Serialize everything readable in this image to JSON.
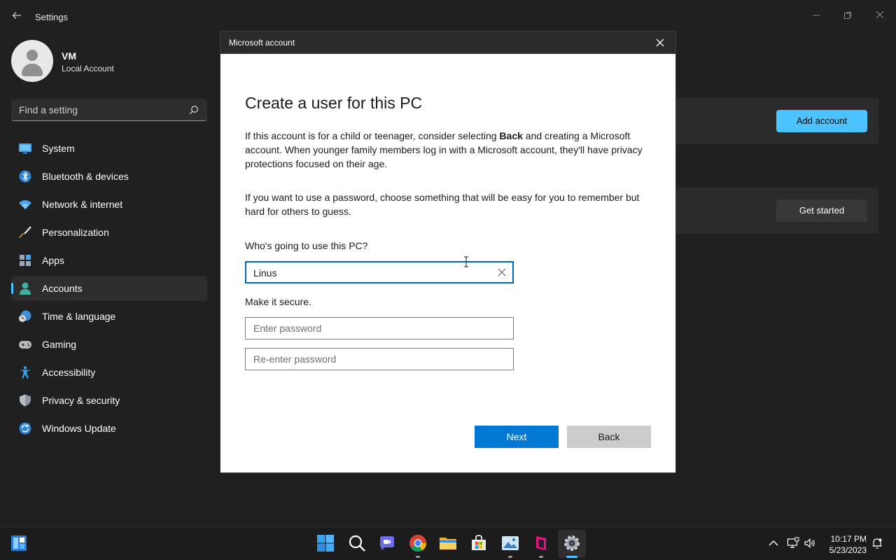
{
  "window": {
    "title": "Settings",
    "back_icon": "arrow-left-icon",
    "controls": [
      "minimize-icon",
      "maximize-icon",
      "close-icon"
    ]
  },
  "profile": {
    "name": "VM",
    "account_type": "Local Account"
  },
  "search": {
    "placeholder": "Find a setting"
  },
  "nav": {
    "items": [
      {
        "label": "System",
        "icon": "display-icon"
      },
      {
        "label": "Bluetooth & devices",
        "icon": "bluetooth-icon"
      },
      {
        "label": "Network & internet",
        "icon": "wifi-icon"
      },
      {
        "label": "Personalization",
        "icon": "brush-icon"
      },
      {
        "label": "Apps",
        "icon": "apps-icon"
      },
      {
        "label": "Accounts",
        "icon": "person-icon",
        "active": true
      },
      {
        "label": "Time & language",
        "icon": "clock-globe-icon"
      },
      {
        "label": "Gaming",
        "icon": "gamepad-icon"
      },
      {
        "label": "Accessibility",
        "icon": "accessibility-icon"
      },
      {
        "label": "Privacy & security",
        "icon": "shield-icon"
      },
      {
        "label": "Windows Update",
        "icon": "update-icon"
      }
    ]
  },
  "background_cards": {
    "add_account_label": "Add account",
    "get_started_label": "Get started"
  },
  "dialog": {
    "title": "Microsoft account",
    "heading": "Create a user for this PC",
    "para1_before": "If this account is for a child or teenager, consider selecting ",
    "para1_bold": "Back",
    "para1_after": " and creating a Microsoft account. When younger family members log in with a Microsoft account, they'll have privacy protections focused on their age.",
    "para2": "If you want to use a password, choose something that will be easy for you to remember but hard for others to guess.",
    "who_label": "Who's going to use this PC?",
    "username_value": "Linus",
    "secure_label": "Make it secure.",
    "password_placeholder": "Enter password",
    "reenter_placeholder": "Re-enter password",
    "next_label": "Next",
    "back_label": "Back"
  },
  "taskbar": {
    "apps": [
      "start-icon",
      "search-icon",
      "teams-chat-icon",
      "chrome-icon",
      "file-explorer-icon",
      "store-icon",
      "photos-icon",
      "app-icon",
      "settings-icon"
    ],
    "accent": "#4cc2ff"
  },
  "tray": {
    "time": "10:17 PM",
    "date": "5/23/2023"
  },
  "colors": {
    "accent": "#4cc2ff",
    "primary_button": "#0078d4",
    "background": "#202020"
  }
}
